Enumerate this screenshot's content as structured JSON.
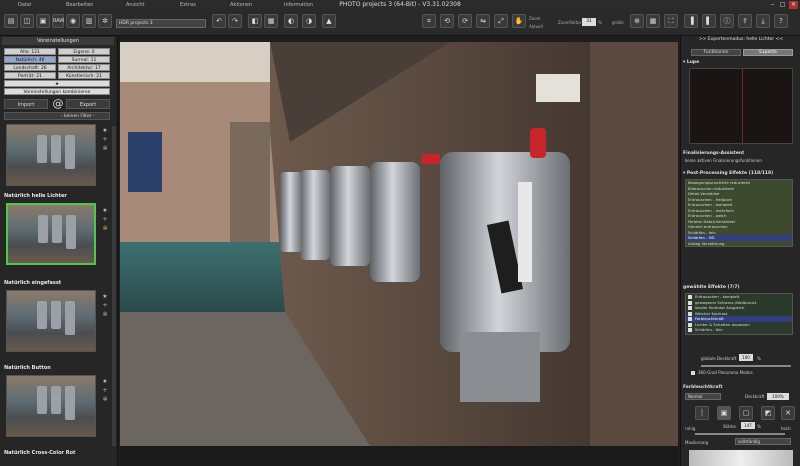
{
  "window": {
    "title": "PHOTO projects 3 (64-Bit) - V3.31.02308",
    "minimize": "‒",
    "maximize": "□",
    "close": "✕"
  },
  "menu": [
    "Datei",
    "Bearbeiten",
    "Ansicht",
    "Extras",
    "Aktionen",
    "Information"
  ],
  "toolbar": {
    "raw": "RAW",
    "project": "HDR projects 3",
    "zoom_label": "Zoom",
    "zoom_sub": "Aktuell",
    "zoomstep_label": "Zoomfaktor",
    "zoom_value": "31",
    "zoom_unit": "%",
    "fit_label": "große"
  },
  "left": {
    "header": "Voreinstellungen",
    "filters": [
      [
        "Alle: 121",
        "Eigene: 0"
      ],
      [
        "Natürlich: 46",
        "Surreal: 11"
      ],
      [
        "Landschaft: 26",
        "Architektur: 17"
      ],
      [
        "Porträt: 21",
        "Künstlerisch: 21"
      ]
    ],
    "star": "★",
    "combine": "Voreinstellungen kombinieren",
    "import": "Import",
    "at": "@",
    "export": "Export",
    "filter_select": "- keinen Filter -",
    "presets": [
      {
        "name": ""
      },
      {
        "name": "Natürlich helle Lichter"
      },
      {
        "name": "Natürlich eingefasst"
      },
      {
        "name": "Natürlich Button"
      },
      {
        "name": "Natürlich Cross-Color Rot"
      }
    ]
  },
  "right": {
    "header": ">> Expertenmodus: helle Lichter <<",
    "tabs": [
      "Funktionen",
      "Experte"
    ],
    "loupe": "Lupe",
    "assistant_title": "Finalisierungs-Assistent",
    "assistant_text": "keine aktiven Finalisierungsfunktionen",
    "post_title": "Post-Processing Effekte (118/118)",
    "post_items": [
      "Bewegungsunschärfe reduzieren",
      "Bildrauschen reduzieren",
      "Detail-Verstärker",
      "Entrauschen - Hellpixel",
      "Entrauschen - komplett",
      "Entrauschen - mehrfach",
      "Entrauschen - weich",
      "Farbton Detail-Verstärker",
      "Himmel entrauschen",
      "Schärfen - fein",
      "Schärfen - HD",
      "Airbag Verstärkung"
    ],
    "post_selected": 10,
    "selected_title": "gewählte Effekte (7/7)",
    "selected_items": [
      "Entrauschen - komplett",
      "gewogener Schwarz-/Weißpunkt",
      "lokaler Kontrast Ausgleich",
      "Weicher Kontrast",
      "Farbleuchtkraft",
      "Lichter & Schatten anpassen",
      "Schärfen - fein"
    ],
    "selected_highlight": 4,
    "global_mix_label": "globale Deckkraft",
    "global_mix_value": "100",
    "global_mix_unit": "%",
    "panorama": "360-Grad Panorama Modus",
    "brush_title": "Farbleuchtkraft",
    "blend_mode": "Normal",
    "opacity_label": "Deckkraft",
    "opacity_value": "100%",
    "strength_left": "ruhig",
    "strength_label": "Stärke",
    "strength_value": "147",
    "strength_unit": "%",
    "strength_right": "hoch",
    "masking_label": "Maskierung",
    "masking_value": "vollständig"
  },
  "colors": {
    "accent": "#4fc74f",
    "selection": "#2f3f80"
  }
}
